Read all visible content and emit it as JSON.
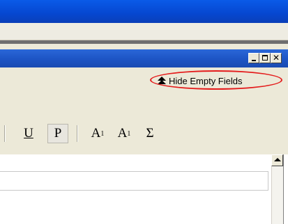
{
  "inner_window": {
    "controls": {
      "minimize": "_",
      "maximize": "□",
      "close": "✕"
    }
  },
  "panel": {
    "hide_empty_fields": {
      "icon": "double-up-arrow-icon",
      "label": "Hide Empty Fields"
    }
  },
  "toolbar": {
    "underline": "U",
    "plain": "P",
    "superscript": {
      "base": "A",
      "mark": "1"
    },
    "subscript": {
      "base": "A",
      "mark": "1"
    },
    "sum": "Σ"
  },
  "colors": {
    "title_blue": "#0a5be8",
    "annotation_red": "#e41b1b",
    "panel_beige": "#ece9d8"
  }
}
